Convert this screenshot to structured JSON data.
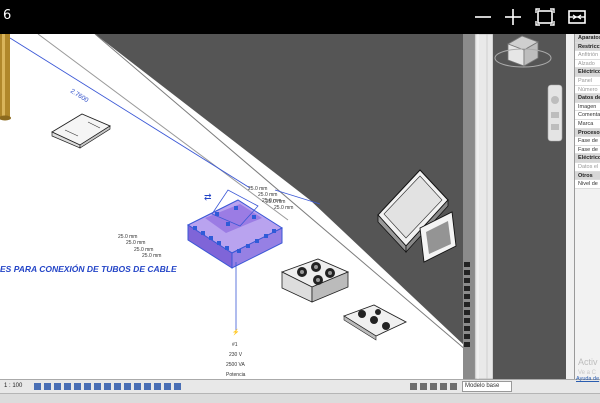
{
  "window": {
    "number": "6"
  },
  "controls": {
    "minimize_icon": "minimize-icon",
    "add_icon": "plus-icon",
    "fullscreen_icon": "fullscreen-icon",
    "restore_icon": "restore-icon"
  },
  "canvas": {
    "dimension_long": "2.7600",
    "dim_labels_right": [
      "25.0 mm",
      "25.0 mm",
      "25.0 mm",
      "25.0 mm",
      "25.0 mm"
    ],
    "dim_labels_left": [
      "25.0 mm",
      "25.0 mm",
      "25.0 mm",
      "25.0 mm"
    ],
    "title_text": "ES PARA CONEXIÓN DE TUBOS DE CABLE",
    "tag_lines": [
      "#1",
      "230 V",
      "2500 VA",
      "Potencia"
    ]
  },
  "properties": {
    "rows": [
      {
        "text": "Aparatos",
        "kind": "hdr"
      },
      {
        "text": "Restricción",
        "kind": "hdr"
      },
      {
        "text": "Anfitrión",
        "kind": "dim"
      },
      {
        "text": "Alzado",
        "kind": "dim"
      },
      {
        "text": "Eléctrico",
        "kind": "hdr"
      },
      {
        "text": "Panel",
        "kind": "dim"
      },
      {
        "text": "Número",
        "kind": "dim"
      },
      {
        "text": "Datos de",
        "kind": "hdr"
      },
      {
        "text": "Imagen",
        "kind": ""
      },
      {
        "text": "Comentar",
        "kind": ""
      },
      {
        "text": "Marca",
        "kind": ""
      },
      {
        "text": "Proceso p",
        "kind": "hdr"
      },
      {
        "text": "Fase de",
        "kind": ""
      },
      {
        "text": "Fase de",
        "kind": ""
      },
      {
        "text": "Eléctrico",
        "kind": "hdr"
      },
      {
        "text": "Datos el",
        "kind": "dim"
      },
      {
        "text": "Otros",
        "kind": "hdr"
      },
      {
        "text": "Nivel de",
        "kind": ""
      }
    ],
    "activation_title": "Activ",
    "activation_sub": "Ve a C",
    "help_link": "Ayuda de"
  },
  "status": {
    "scale": "1 : 100",
    "model": "Modelo base"
  },
  "colors": {
    "accent_blue": "#3a57d6",
    "selection": "#8e6be0",
    "dark_bg": "#5a5a5a",
    "title_blue": "#2445c7"
  }
}
